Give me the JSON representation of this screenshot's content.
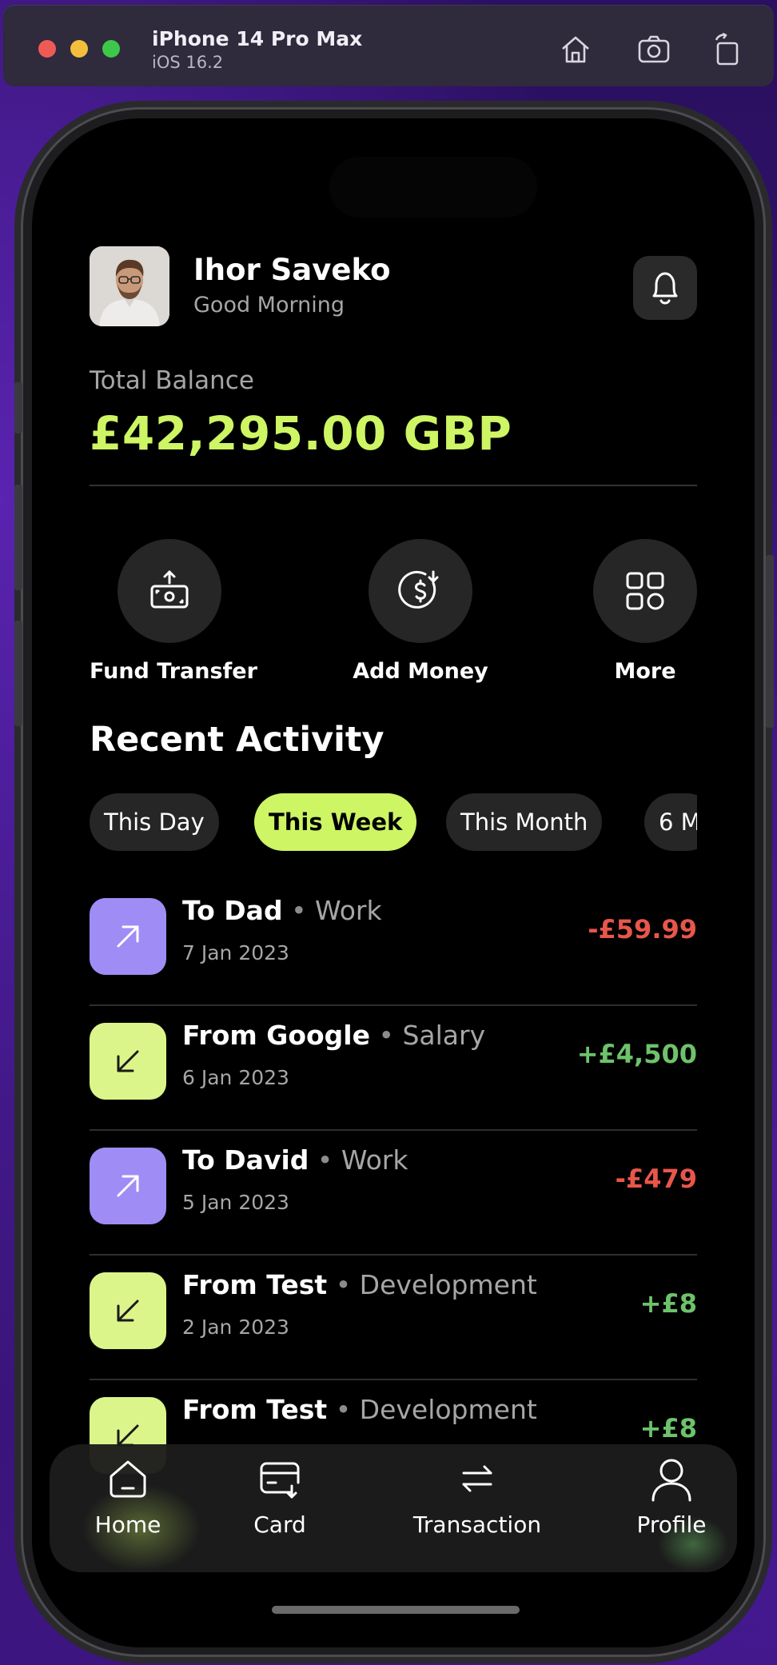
{
  "simulator": {
    "device_name": "iPhone 14 Pro Max",
    "os_version": "iOS 16.2",
    "toolbar_icons": [
      "home-icon",
      "screenshot-icon",
      "rotate-icon"
    ]
  },
  "header": {
    "user_name": "Ihor Saveko",
    "greeting": "Good Morning",
    "notification_icon": "bell-icon"
  },
  "balance": {
    "label": "Total Balance",
    "amount": "£42,295.00 GBP",
    "accent_color": "#cdf564"
  },
  "quick_actions": [
    {
      "label": "Fund Transfer",
      "icon": "money-transfer-icon"
    },
    {
      "label": "Add Money",
      "icon": "add-money-icon"
    },
    {
      "label": "More",
      "icon": "grid-icon"
    }
  ],
  "recent_activity": {
    "title": "Recent Activity",
    "filters": [
      {
        "label": "This Day",
        "active": false
      },
      {
        "label": "This Week",
        "active": true
      },
      {
        "label": "This Month",
        "active": false
      },
      {
        "label": "6 M",
        "active": false
      }
    ],
    "transactions": [
      {
        "name": "To Dad",
        "category": "Work",
        "date": "7 Jan 2023",
        "amount": "-£59.99",
        "direction": "out"
      },
      {
        "name": "From Google",
        "category": "Salary",
        "date": "6 Jan 2023",
        "amount": "+£4,500",
        "direction": "in"
      },
      {
        "name": "To David",
        "category": "Work",
        "date": "5 Jan 2023",
        "amount": "-£479",
        "direction": "out"
      },
      {
        "name": "From Test",
        "category": "Development",
        "date": "2 Jan 2023",
        "amount": "+£8",
        "direction": "in"
      },
      {
        "name": "From Test",
        "category": "Development",
        "date": "",
        "amount": "+£8",
        "direction": "in"
      }
    ],
    "separator": "•"
  },
  "bottom_nav": [
    {
      "label": "Home",
      "icon": "home-icon"
    },
    {
      "label": "Card",
      "icon": "card-icon"
    },
    {
      "label": "Transaction",
      "icon": "transfer-arrows-icon"
    },
    {
      "label": "Profile",
      "icon": "user-icon"
    }
  ],
  "colors": {
    "negative": "#e8564b",
    "positive": "#6ec26b",
    "outgoing_icon_bg": "#9f8df5",
    "incoming_icon_bg": "#dcf58a"
  }
}
